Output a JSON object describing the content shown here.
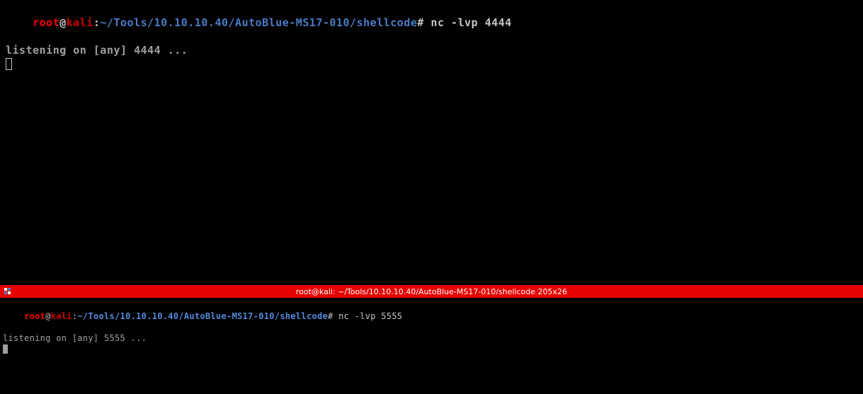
{
  "top_pane": {
    "prompt": {
      "user": "root",
      "at": "@",
      "host": "kali",
      "colon": ":",
      "path": "~/Tools/10.10.10.40/AutoBlue-MS17-010/shellcode",
      "hash": "#",
      "command": " nc -lvp 4444"
    },
    "output": "listening on [any] 4444 ..."
  },
  "title_bar": {
    "title": "root@kali: ~/Tools/10.10.10.40/AutoBlue-MS17-010/shellcode 205x26"
  },
  "bottom_pane": {
    "prompt": {
      "user": "root",
      "at": "@",
      "host": "kali",
      "colon": ":",
      "path": "~/Tools/10.10.10.40/AutoBlue-MS17-010/shellcode",
      "hash": "#",
      "command": " nc -lvp 5555"
    },
    "output": "listening on [any] 5555 ..."
  }
}
